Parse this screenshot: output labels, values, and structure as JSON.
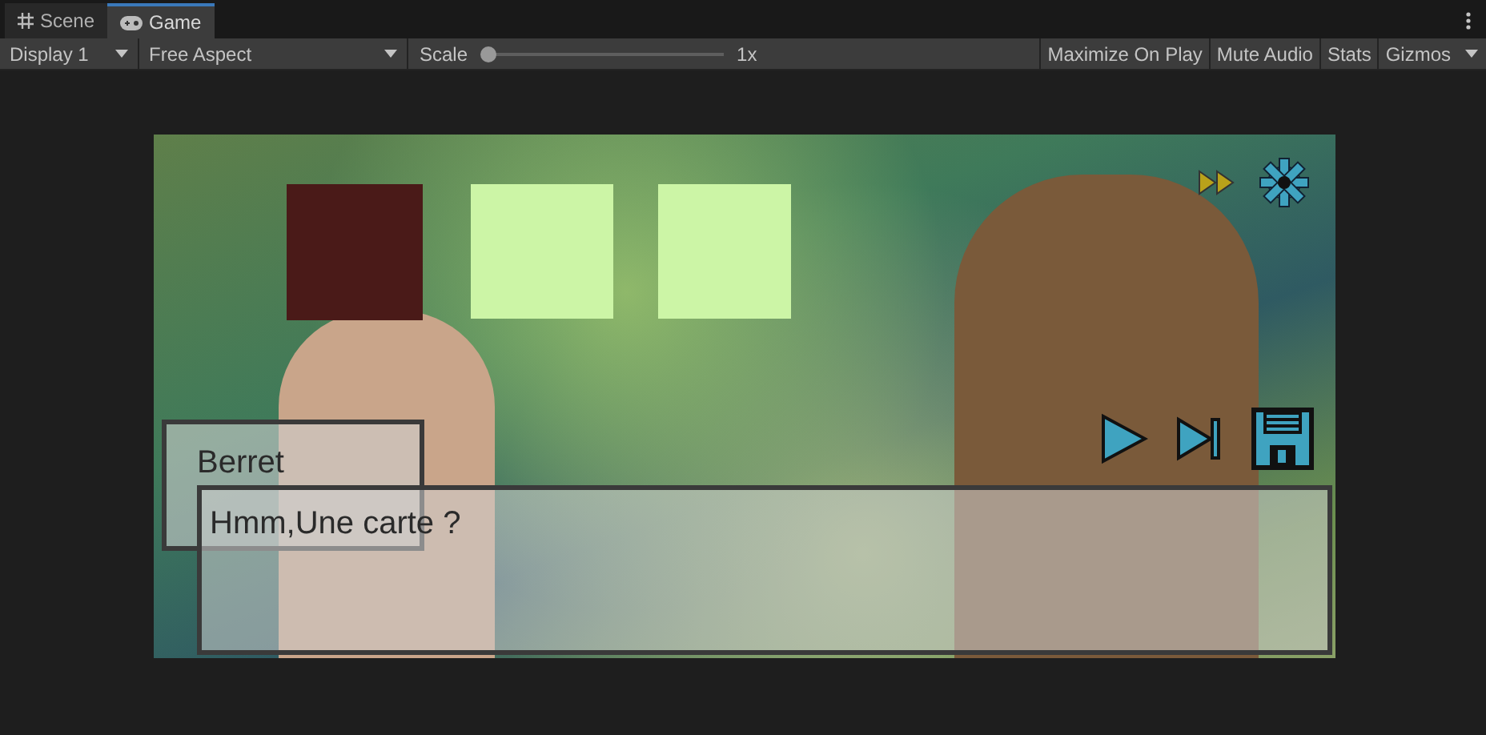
{
  "tabs": [
    {
      "label": "Scene",
      "kind": "scene",
      "selected": false
    },
    {
      "label": "Game",
      "kind": "game",
      "selected": true
    }
  ],
  "toolbar": {
    "display": "Display 1",
    "aspect": "Free Aspect",
    "scale_label": "Scale",
    "scale": {
      "level": 0.0
    },
    "scale_reading": "1x",
    "buttons": [
      "Maximize On Play",
      "Mute Audio",
      "Stats",
      "Gizmos"
    ]
  },
  "game": {
    "slots": [
      {
        "color": "#4a1a18"
      },
      {
        "color": "#ccf5a6"
      },
      {
        "color": "#ccf5a6"
      }
    ],
    "dialogue": {
      "speaker": "Berret",
      "line": "Hmm,Une carte ?"
    }
  }
}
